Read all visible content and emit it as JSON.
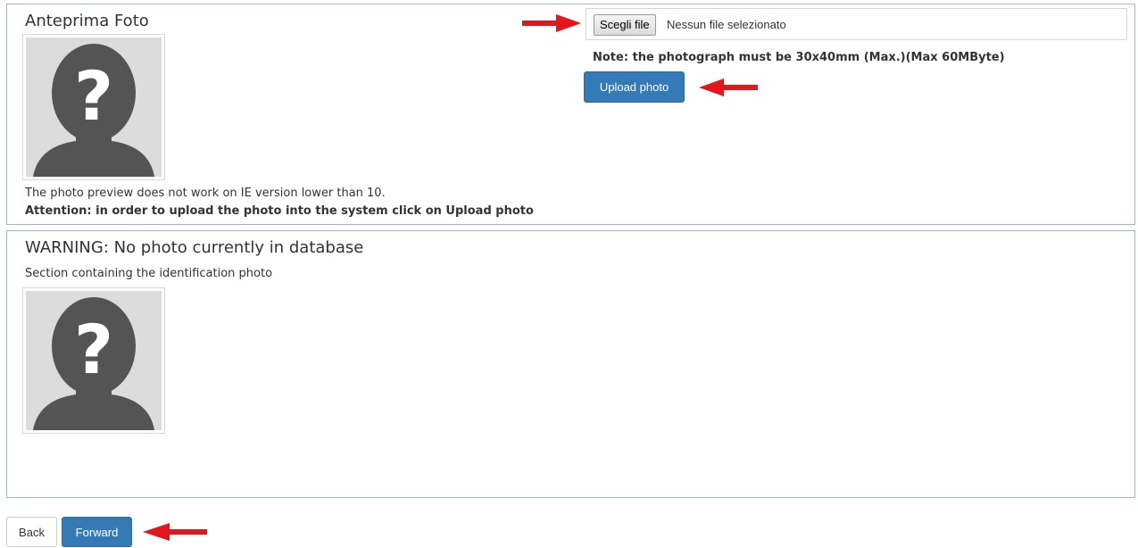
{
  "upload_section": {
    "title": "Anteprima Foto",
    "choose_file_label": "Scegli file",
    "file_status": "Nessun file selezionato",
    "note": "Note: the photograph must be 30x40mm (Max.)(Max 60MByte)",
    "upload_button_label": "Upload photo",
    "ie_notice": "The photo preview does not work on IE version lower than 10.",
    "attention": "Attention: in order to upload the photo into the system click on Upload photo"
  },
  "current_section": {
    "title": "WARNING: No photo currently in database",
    "subtitle": "Section containing the identification photo"
  },
  "footer": {
    "back_label": "Back",
    "forward_label": "Forward"
  },
  "colors": {
    "primary": "#337ab7",
    "annotation_arrow": "#e3161c",
    "placeholder_silhouette": "#545454"
  },
  "icons": {
    "photo_placeholder": "question-mark-silhouette",
    "annotation": "red-arrow-left"
  }
}
